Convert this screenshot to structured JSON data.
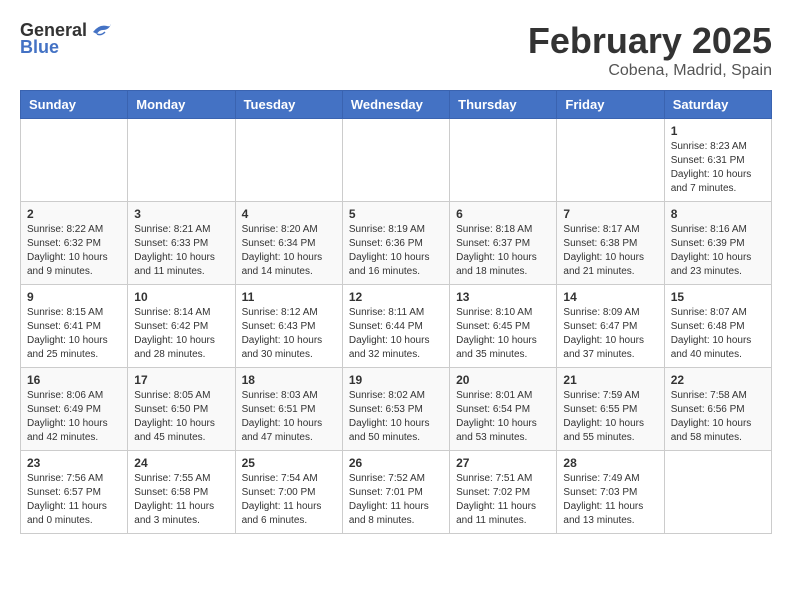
{
  "header": {
    "logo": {
      "general": "General",
      "blue": "Blue"
    },
    "title": "February 2025",
    "location": "Cobena, Madrid, Spain"
  },
  "weekdays": [
    "Sunday",
    "Monday",
    "Tuesday",
    "Wednesday",
    "Thursday",
    "Friday",
    "Saturday"
  ],
  "weeks": [
    [
      null,
      null,
      null,
      null,
      null,
      null,
      {
        "day": "1",
        "sunrise": "Sunrise: 8:23 AM",
        "sunset": "Sunset: 6:31 PM",
        "daylight": "Daylight: 10 hours and 7 minutes."
      }
    ],
    [
      {
        "day": "2",
        "sunrise": "Sunrise: 8:22 AM",
        "sunset": "Sunset: 6:32 PM",
        "daylight": "Daylight: 10 hours and 9 minutes."
      },
      {
        "day": "3",
        "sunrise": "Sunrise: 8:21 AM",
        "sunset": "Sunset: 6:33 PM",
        "daylight": "Daylight: 10 hours and 11 minutes."
      },
      {
        "day": "4",
        "sunrise": "Sunrise: 8:20 AM",
        "sunset": "Sunset: 6:34 PM",
        "daylight": "Daylight: 10 hours and 14 minutes."
      },
      {
        "day": "5",
        "sunrise": "Sunrise: 8:19 AM",
        "sunset": "Sunset: 6:36 PM",
        "daylight": "Daylight: 10 hours and 16 minutes."
      },
      {
        "day": "6",
        "sunrise": "Sunrise: 8:18 AM",
        "sunset": "Sunset: 6:37 PM",
        "daylight": "Daylight: 10 hours and 18 minutes."
      },
      {
        "day": "7",
        "sunrise": "Sunrise: 8:17 AM",
        "sunset": "Sunset: 6:38 PM",
        "daylight": "Daylight: 10 hours and 21 minutes."
      },
      {
        "day": "8",
        "sunrise": "Sunrise: 8:16 AM",
        "sunset": "Sunset: 6:39 PM",
        "daylight": "Daylight: 10 hours and 23 minutes."
      }
    ],
    [
      {
        "day": "9",
        "sunrise": "Sunrise: 8:15 AM",
        "sunset": "Sunset: 6:41 PM",
        "daylight": "Daylight: 10 hours and 25 minutes."
      },
      {
        "day": "10",
        "sunrise": "Sunrise: 8:14 AM",
        "sunset": "Sunset: 6:42 PM",
        "daylight": "Daylight: 10 hours and 28 minutes."
      },
      {
        "day": "11",
        "sunrise": "Sunrise: 8:12 AM",
        "sunset": "Sunset: 6:43 PM",
        "daylight": "Daylight: 10 hours and 30 minutes."
      },
      {
        "day": "12",
        "sunrise": "Sunrise: 8:11 AM",
        "sunset": "Sunset: 6:44 PM",
        "daylight": "Daylight: 10 hours and 32 minutes."
      },
      {
        "day": "13",
        "sunrise": "Sunrise: 8:10 AM",
        "sunset": "Sunset: 6:45 PM",
        "daylight": "Daylight: 10 hours and 35 minutes."
      },
      {
        "day": "14",
        "sunrise": "Sunrise: 8:09 AM",
        "sunset": "Sunset: 6:47 PM",
        "daylight": "Daylight: 10 hours and 37 minutes."
      },
      {
        "day": "15",
        "sunrise": "Sunrise: 8:07 AM",
        "sunset": "Sunset: 6:48 PM",
        "daylight": "Daylight: 10 hours and 40 minutes."
      }
    ],
    [
      {
        "day": "16",
        "sunrise": "Sunrise: 8:06 AM",
        "sunset": "Sunset: 6:49 PM",
        "daylight": "Daylight: 10 hours and 42 minutes."
      },
      {
        "day": "17",
        "sunrise": "Sunrise: 8:05 AM",
        "sunset": "Sunset: 6:50 PM",
        "daylight": "Daylight: 10 hours and 45 minutes."
      },
      {
        "day": "18",
        "sunrise": "Sunrise: 8:03 AM",
        "sunset": "Sunset: 6:51 PM",
        "daylight": "Daylight: 10 hours and 47 minutes."
      },
      {
        "day": "19",
        "sunrise": "Sunrise: 8:02 AM",
        "sunset": "Sunset: 6:53 PM",
        "daylight": "Daylight: 10 hours and 50 minutes."
      },
      {
        "day": "20",
        "sunrise": "Sunrise: 8:01 AM",
        "sunset": "Sunset: 6:54 PM",
        "daylight": "Daylight: 10 hours and 53 minutes."
      },
      {
        "day": "21",
        "sunrise": "Sunrise: 7:59 AM",
        "sunset": "Sunset: 6:55 PM",
        "daylight": "Daylight: 10 hours and 55 minutes."
      },
      {
        "day": "22",
        "sunrise": "Sunrise: 7:58 AM",
        "sunset": "Sunset: 6:56 PM",
        "daylight": "Daylight: 10 hours and 58 minutes."
      }
    ],
    [
      {
        "day": "23",
        "sunrise": "Sunrise: 7:56 AM",
        "sunset": "Sunset: 6:57 PM",
        "daylight": "Daylight: 11 hours and 0 minutes."
      },
      {
        "day": "24",
        "sunrise": "Sunrise: 7:55 AM",
        "sunset": "Sunset: 6:58 PM",
        "daylight": "Daylight: 11 hours and 3 minutes."
      },
      {
        "day": "25",
        "sunrise": "Sunrise: 7:54 AM",
        "sunset": "Sunset: 7:00 PM",
        "daylight": "Daylight: 11 hours and 6 minutes."
      },
      {
        "day": "26",
        "sunrise": "Sunrise: 7:52 AM",
        "sunset": "Sunset: 7:01 PM",
        "daylight": "Daylight: 11 hours and 8 minutes."
      },
      {
        "day": "27",
        "sunrise": "Sunrise: 7:51 AM",
        "sunset": "Sunset: 7:02 PM",
        "daylight": "Daylight: 11 hours and 11 minutes."
      },
      {
        "day": "28",
        "sunrise": "Sunrise: 7:49 AM",
        "sunset": "Sunset: 7:03 PM",
        "daylight": "Daylight: 11 hours and 13 minutes."
      },
      null
    ]
  ]
}
